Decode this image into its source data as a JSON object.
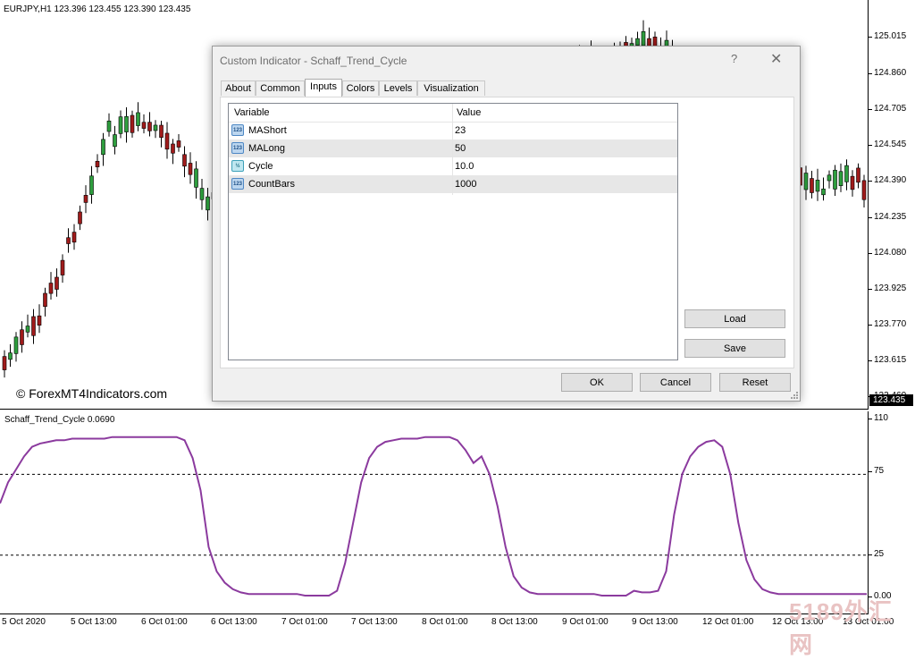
{
  "chart": {
    "symbol_info": "EURJPY,H1  123.396 123.455 123.390 123.435",
    "watermark": "© ForexMT4Indicators.com",
    "current_price": "123.435",
    "price_scale": [
      "125.015",
      "124.860",
      "124.705",
      "124.545",
      "124.390",
      "124.235",
      "124.080",
      "123.925",
      "123.770",
      "123.615",
      "123.460"
    ],
    "time_labels": [
      "5 Oct 2020",
      "5 Oct 13:00",
      "6 Oct 01:00",
      "6 Oct 13:00",
      "7 Oct 01:00",
      "7 Oct 13:00",
      "8 Oct 01:00",
      "8 Oct 13:00",
      "9 Oct 01:00",
      "9 Oct 13:00",
      "12 Oct 01:00",
      "12 Oct 13:00",
      "13 Oct 01:00"
    ],
    "site_watermark": "5189外汇网"
  },
  "indicator": {
    "title": "Schaff_Trend_Cycle 0.0690",
    "scale": [
      "110",
      "75",
      "25",
      "0.00"
    ],
    "levels": [
      75,
      25
    ],
    "line_color": "#8b3a9e",
    "series": [
      57,
      70,
      78,
      86,
      92,
      94,
      95,
      96,
      96,
      97,
      97,
      97,
      97,
      97,
      98,
      98,
      98,
      98,
      98,
      98,
      98,
      98,
      98,
      96,
      85,
      65,
      30,
      15,
      8,
      4,
      2,
      1,
      1,
      1,
      1,
      1,
      1,
      1,
      0,
      0,
      0,
      0,
      3,
      20,
      45,
      70,
      85,
      92,
      95,
      96,
      97,
      97,
      97,
      98,
      98,
      98,
      98,
      96,
      90,
      82,
      86,
      75,
      55,
      30,
      12,
      5,
      2,
      1,
      1,
      1,
      1,
      1,
      1,
      1,
      1,
      0,
      0,
      0,
      0,
      3,
      2,
      2,
      3,
      15,
      50,
      75,
      86,
      92,
      95,
      96,
      92,
      75,
      45,
      22,
      10,
      4,
      2,
      1,
      1,
      1,
      1,
      1,
      1,
      1,
      1,
      1,
      1,
      1,
      1
    ]
  },
  "dialog": {
    "title": "Custom Indicator - Schaff_Trend_Cycle",
    "help": "?",
    "close": "✕",
    "tabs": [
      "About",
      "Common",
      "Inputs",
      "Colors",
      "Levels",
      "Visualization"
    ],
    "active_tab": "Inputs",
    "grid": {
      "col_variable": "Variable",
      "col_value": "Value",
      "rows": [
        {
          "type_icon": "123",
          "type": "int",
          "name": "MAShort",
          "value": "23"
        },
        {
          "type_icon": "123",
          "type": "int",
          "name": "MALong",
          "value": "50"
        },
        {
          "type_icon": "½",
          "type": "double",
          "name": "Cycle",
          "value": "10.0"
        },
        {
          "type_icon": "123",
          "type": "int",
          "name": "CountBars",
          "value": "1000"
        }
      ]
    },
    "buttons": {
      "load": "Load",
      "save": "Save",
      "ok": "OK",
      "cancel": "Cancel",
      "reset": "Reset"
    }
  },
  "colors": {
    "bull": "#2e9e3e",
    "bear": "#a01b1b",
    "indicator": "#8b3a9e"
  }
}
